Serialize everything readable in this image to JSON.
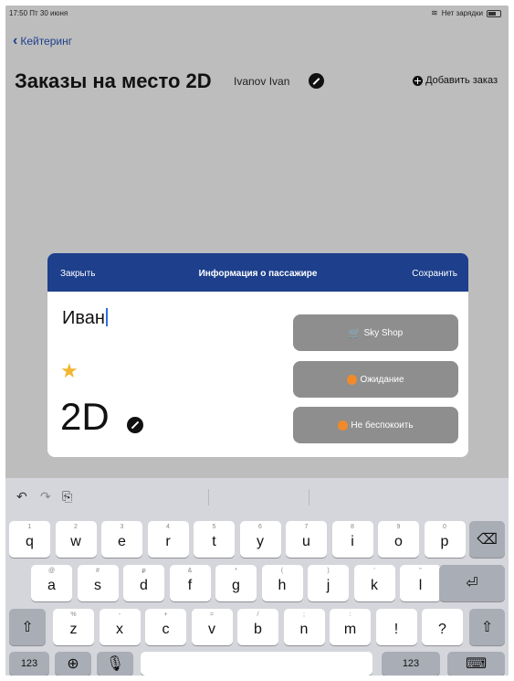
{
  "status_bar": {
    "time": "17:50 Пт 30 июня",
    "wifi_icon": "wifi-icon",
    "battery_text": "Нет зарядки"
  },
  "nav": {
    "back_label": "Кейтеринг",
    "title": "Заказы на место 2D",
    "user": "Ivanov Ivan",
    "add_order": "Добавить заказ"
  },
  "modal": {
    "close": "Закрыть",
    "title": "Информация о пассажире",
    "save": "Сохранить",
    "passenger_name": "Иван",
    "seat": "2D",
    "buttons": [
      {
        "label": "Sky Shop",
        "icon": "cart-icon"
      },
      {
        "label": "Ожидание",
        "icon": "clock-icon"
      },
      {
        "label": "Не беспокоить",
        "icon": "dnd-icon"
      }
    ],
    "accent_color": "#1d3f8c",
    "star_color": "#f2b632",
    "icon_color": "#f08a2a"
  },
  "keyboard": {
    "row1": [
      {
        "hint": "1",
        "key": "q"
      },
      {
        "hint": "2",
        "key": "w"
      },
      {
        "hint": "3",
        "key": "e"
      },
      {
        "hint": "4",
        "key": "r"
      },
      {
        "hint": "5",
        "key": "t"
      },
      {
        "hint": "6",
        "key": "y"
      },
      {
        "hint": "7",
        "key": "u"
      },
      {
        "hint": "8",
        "key": "i"
      },
      {
        "hint": "9",
        "key": "o"
      },
      {
        "hint": "0",
        "key": "p"
      }
    ],
    "row2": [
      {
        "hint": "@",
        "key": "a"
      },
      {
        "hint": "#",
        "key": "s"
      },
      {
        "hint": "₽",
        "key": "d"
      },
      {
        "hint": "&",
        "key": "f"
      },
      {
        "hint": "*",
        "key": "g"
      },
      {
        "hint": "(",
        "key": "h"
      },
      {
        "hint": ")",
        "key": "j"
      },
      {
        "hint": "'",
        "key": "k"
      },
      {
        "hint": "\"",
        "key": "l"
      }
    ],
    "row3": [
      {
        "hint": "%",
        "key": "z"
      },
      {
        "hint": "-",
        "key": "x"
      },
      {
        "hint": "+",
        "key": "c"
      },
      {
        "hint": "=",
        "key": "v"
      },
      {
        "hint": "/",
        "key": "b"
      },
      {
        "hint": ";",
        "key": "n"
      },
      {
        "hint": ":",
        "key": "m"
      },
      {
        "hint": "",
        "key": "!"
      },
      {
        "hint": "",
        "key": "?"
      }
    ],
    "num_left": "123",
    "num_right": "123"
  }
}
